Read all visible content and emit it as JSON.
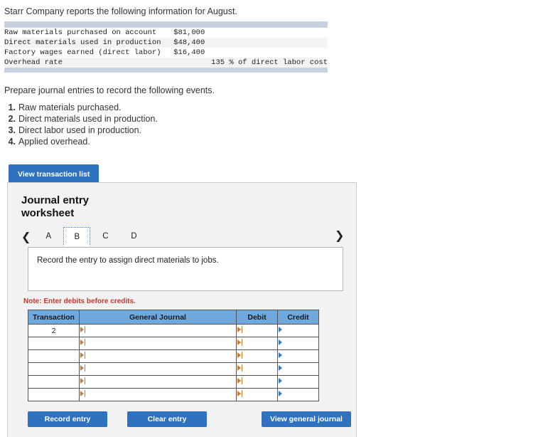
{
  "intro": {
    "text": "Starr Company reports the following information for August."
  },
  "facts_table": {
    "rows": [
      {
        "label": "Raw materials purchased on account",
        "value": "$81,000",
        "indented": false
      },
      {
        "label": "Direct materials used in production",
        "value": "$48,400",
        "indented": false
      },
      {
        "label": "Factory wages earned (direct labor)",
        "value": "$16,400",
        "indented": false
      },
      {
        "label": "Overhead rate",
        "value": "135 % of direct labor cost",
        "indented": true
      }
    ]
  },
  "prompt": {
    "text": "Prepare journal entries to record the following events."
  },
  "events": [
    {
      "label": "Raw materials purchased."
    },
    {
      "label": "Direct materials used in production."
    },
    {
      "label": "Direct labor used in production."
    },
    {
      "label": "Applied overhead."
    }
  ],
  "view_transaction_list_button": {
    "label": "View transaction list"
  },
  "worksheet": {
    "title": "Journal entry worksheet",
    "prev_icon": "chevron-left-icon",
    "next_icon": "chevron-right-icon",
    "tabs": [
      {
        "label": "A",
        "active": false
      },
      {
        "label": "B",
        "active": true
      },
      {
        "label": "C",
        "active": false
      },
      {
        "label": "D",
        "active": false
      }
    ],
    "instruction": "Record the entry to assign direct materials to jobs.",
    "note": "Note: Enter debits before credits.",
    "journal": {
      "columns": [
        "Transaction",
        "General Journal",
        "Debit",
        "Credit"
      ],
      "rows": [
        {
          "transaction": "2",
          "general_journal": "",
          "debit": "",
          "credit": ""
        },
        {
          "transaction": "",
          "general_journal": "",
          "debit": "",
          "credit": ""
        },
        {
          "transaction": "",
          "general_journal": "",
          "debit": "",
          "credit": ""
        },
        {
          "transaction": "",
          "general_journal": "",
          "debit": "",
          "credit": ""
        },
        {
          "transaction": "",
          "general_journal": "",
          "debit": "",
          "credit": ""
        },
        {
          "transaction": "",
          "general_journal": "",
          "debit": "",
          "credit": ""
        }
      ]
    },
    "buttons": {
      "record": "Record entry",
      "clear": "Clear entry",
      "view_general_journal": "View general journal"
    }
  },
  "colors": {
    "accent_blue": "#2f72bf",
    "table_header_blue": "#6fa8dc",
    "note_red": "#c0392b",
    "facts_bar": "#c8d1e0",
    "marker_orange": "#d1792a",
    "marker_blue": "#3a79c2"
  }
}
